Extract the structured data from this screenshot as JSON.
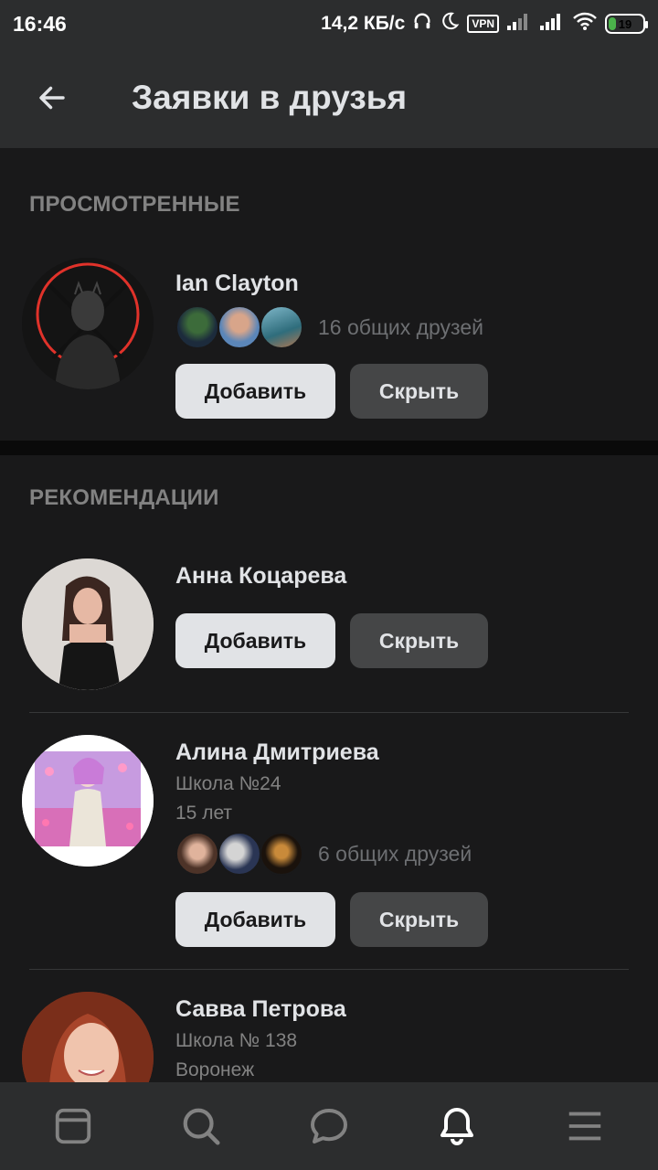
{
  "status_bar": {
    "time": "16:46",
    "network_speed": "14,2 КБ/с",
    "vpn": "VPN",
    "battery": "19"
  },
  "header": {
    "title": "Заявки в друзья"
  },
  "sections": {
    "viewed_title": "ПРОСМОТРЕННЫЕ",
    "recommendations_title": "РЕКОМЕНДАЦИИ"
  },
  "viewed": [
    {
      "name": "Ian Clayton",
      "mutual_friends": "16 общих друзей",
      "add_label": "Добавить",
      "hide_label": "Скрыть"
    }
  ],
  "recommendations": [
    {
      "name": "Анна Коцарева",
      "add_label": "Добавить",
      "hide_label": "Скрыть"
    },
    {
      "name": "Алина Дмитриева",
      "line1": "Школа №24",
      "line2": "15 лет",
      "mutual_friends": "6 общих друзей",
      "add_label": "Добавить",
      "hide_label": "Скрыть"
    },
    {
      "name": "Савва Петрова",
      "line1": "Школа № 138",
      "line2": "Воронеж"
    }
  ],
  "tab_bar": {
    "icons": [
      "news-icon",
      "search-icon",
      "messages-icon",
      "notifications-icon",
      "menu-icon"
    ],
    "active": "notifications-icon"
  },
  "colors": {
    "background": "#19191a",
    "header": "#2c2d2e",
    "primary_button": "#e1e3e6",
    "secondary_button": "#454647",
    "muted_text": "#828282"
  }
}
